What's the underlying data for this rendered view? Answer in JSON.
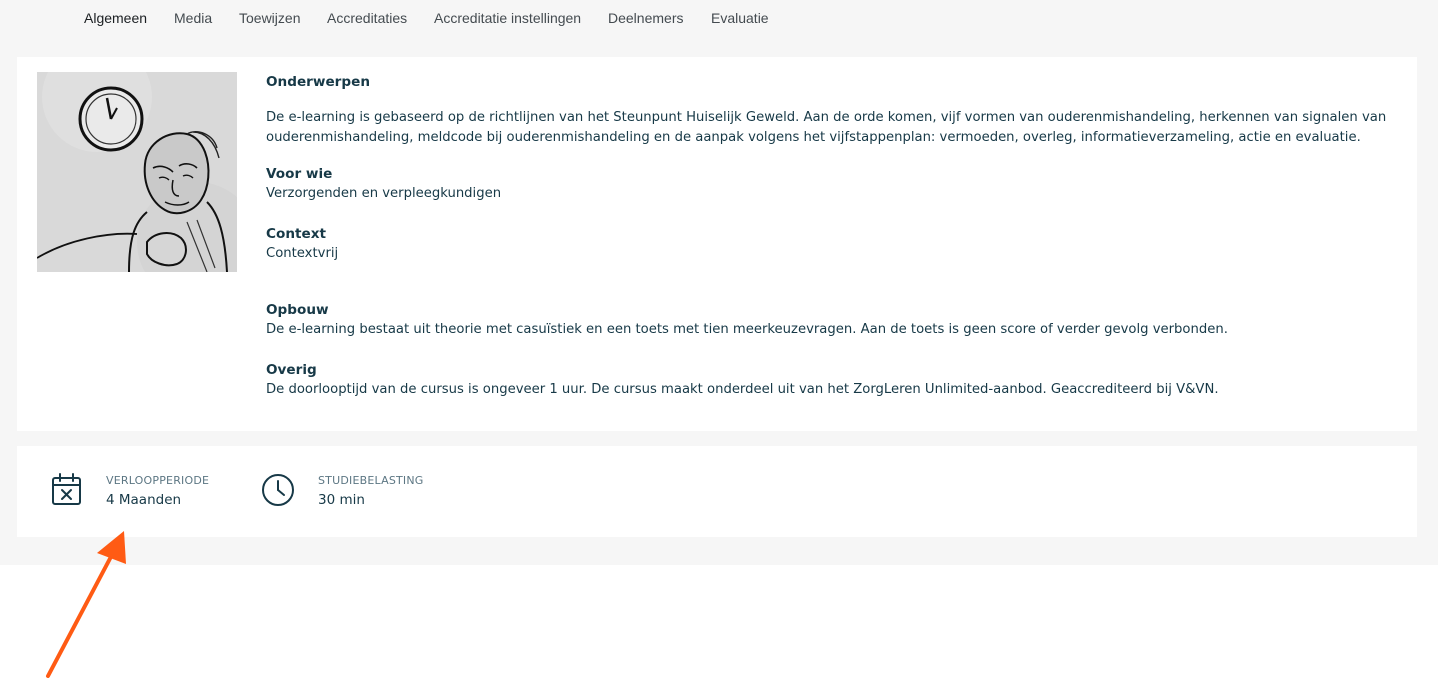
{
  "tabs": [
    {
      "label": "Algemeen",
      "active": true
    },
    {
      "label": "Media",
      "active": false
    },
    {
      "label": "Toewijzen",
      "active": false
    },
    {
      "label": "Accreditaties",
      "active": false
    },
    {
      "label": "Accreditatie instellingen",
      "active": false
    },
    {
      "label": "Deelnemers",
      "active": false
    },
    {
      "label": "Evaluatie",
      "active": false
    }
  ],
  "course": {
    "image_icon": "elderly-man-with-clock-illustration",
    "sections": {
      "onderwerpen": {
        "title": "Onderwerpen",
        "text": "De e-learning is gebaseerd op de richtlijnen van het Steunpunt Huiselijk Geweld. Aan de orde komen, vijf vormen van ouderenmishandeling, herkennen van signalen van ouderenmishandeling, meldcode bij ouderenmishandeling en  de aanpak volgens het vijfstappenplan: vermoeden, overleg, informatieverzameling, actie en evaluatie."
      },
      "voor_wie": {
        "title": "Voor wie",
        "text": "Verzorgenden en verpleegkundigen"
      },
      "context": {
        "title": "Context",
        "text": "Contextvrij"
      },
      "opbouw": {
        "title": "Opbouw",
        "text": "De e-learning bestaat uit theorie met casuïstiek en een toets met tien meerkeuzevragen. Aan de toets is geen score of verder gevolg verbonden."
      },
      "overig": {
        "title": "Overig",
        "text": "De doorlooptijd van de cursus is ongeveer 1 uur. De cursus maakt onderdeel uit van het ZorgLeren Unlimited-aanbod. Geaccrediteerd bij V&VN."
      }
    }
  },
  "info": {
    "expiry": {
      "label": "VERLOOPPERIODE",
      "value": "4 Maanden",
      "icon": "calendar-x-icon"
    },
    "study_load": {
      "label": "STUDIEBELASTING",
      "value": "30 min",
      "icon": "clock-icon"
    }
  },
  "colors": {
    "text_primary": "#173947",
    "label_muted": "#5c7683",
    "page_background": "#f6f6f6",
    "card_background": "#ffffff",
    "annotation_arrow": "#ff5b14"
  }
}
